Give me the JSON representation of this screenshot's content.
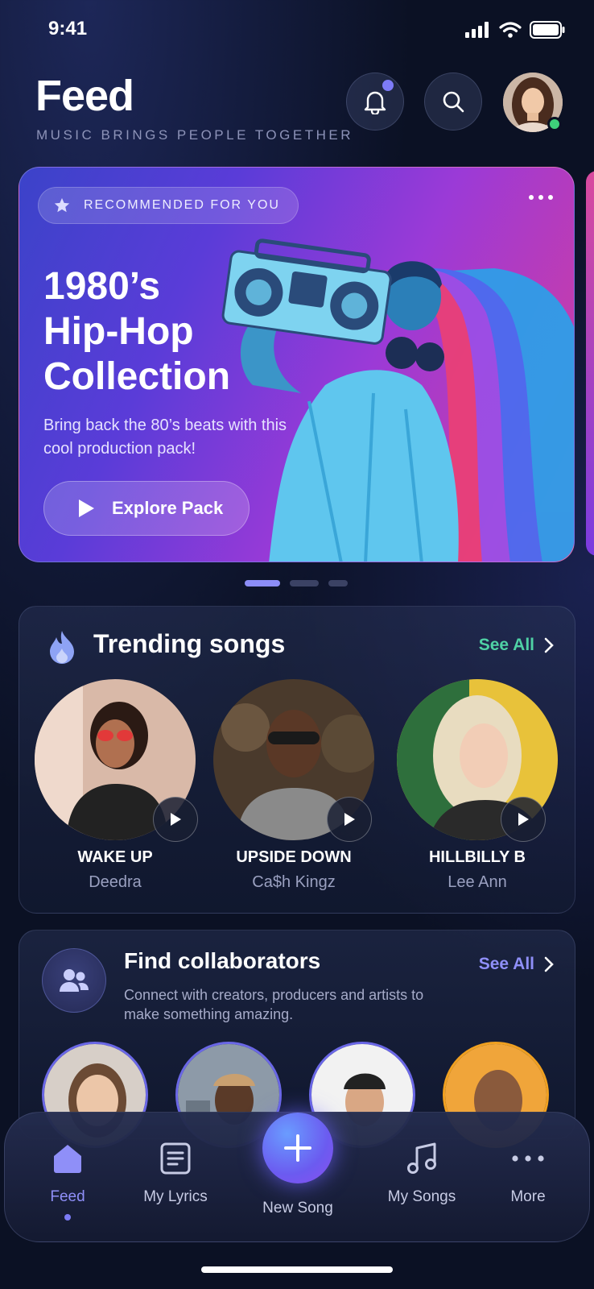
{
  "status_bar": {
    "time": "9:41"
  },
  "header": {
    "title": "Feed",
    "subtitle": "MUSIC BRINGS PEOPLE TOGETHER",
    "icons": [
      "bell-icon",
      "search-icon"
    ]
  },
  "hero": {
    "tag": "RECOMMENDED FOR YOU",
    "title_lines": [
      "1980’s",
      "Hip-Hop",
      "Collection"
    ],
    "description": "Bring back the 80’s beats with this cool production pack!",
    "cta_label": "Explore Pack",
    "carousel": {
      "page_count": 3,
      "current_index": 0
    },
    "colors": {
      "start": "#3b43c9",
      "end": "#d93d99"
    }
  },
  "trending": {
    "title": "Trending songs",
    "see_all": "See All",
    "songs": [
      {
        "name": "WAKE UP",
        "artist": "Deedra"
      },
      {
        "name": "UPSIDE DOWN",
        "artist": "Ca$h Kingz"
      },
      {
        "name": "HILLBILLY B",
        "artist": "Lee Ann"
      }
    ]
  },
  "collaborators": {
    "title": "Find collaborators",
    "see_all": "See All",
    "description": "Connect with creators, producers and artists to make something amazing."
  },
  "tabbar": {
    "tabs": [
      {
        "label": "Feed",
        "icon": "home-icon",
        "active": true
      },
      {
        "label": "My Lyrics",
        "icon": "document-icon",
        "active": false
      },
      {
        "label": "New Song",
        "icon": "plus-icon",
        "active": false
      },
      {
        "label": "My Songs",
        "icon": "music-note-icon",
        "active": false
      },
      {
        "label": "More",
        "icon": "more-icon",
        "active": false
      }
    ]
  },
  "colors": {
    "accent": "#7d7bf7",
    "see_all_trending": "#4fd1a5",
    "see_all_collab": "#8f8ff8",
    "background": "#0b1124"
  }
}
